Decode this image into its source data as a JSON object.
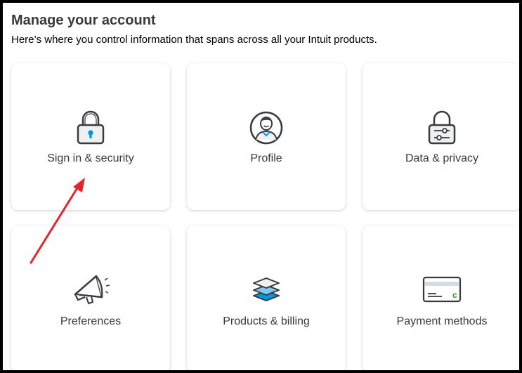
{
  "header": {
    "title": "Manage your account",
    "subtitle": "Here’s where you control information that spans across all your Intuit products."
  },
  "cards": [
    {
      "label": "Sign in & security",
      "icon": "lock-icon"
    },
    {
      "label": "Profile",
      "icon": "person-icon"
    },
    {
      "label": "Data & privacy",
      "icon": "sliders-lock-icon"
    },
    {
      "label": "Preferences",
      "icon": "megaphone-icon"
    },
    {
      "label": "Products & billing",
      "icon": "layers-icon"
    },
    {
      "label": "Payment methods",
      "icon": "credit-card-icon"
    }
  ],
  "colors": {
    "accent_blue": "#0097e6",
    "icon_stroke": "#393a3d",
    "card_accent_green": "#2ca01c",
    "annotation_arrow": "#e8222b"
  }
}
